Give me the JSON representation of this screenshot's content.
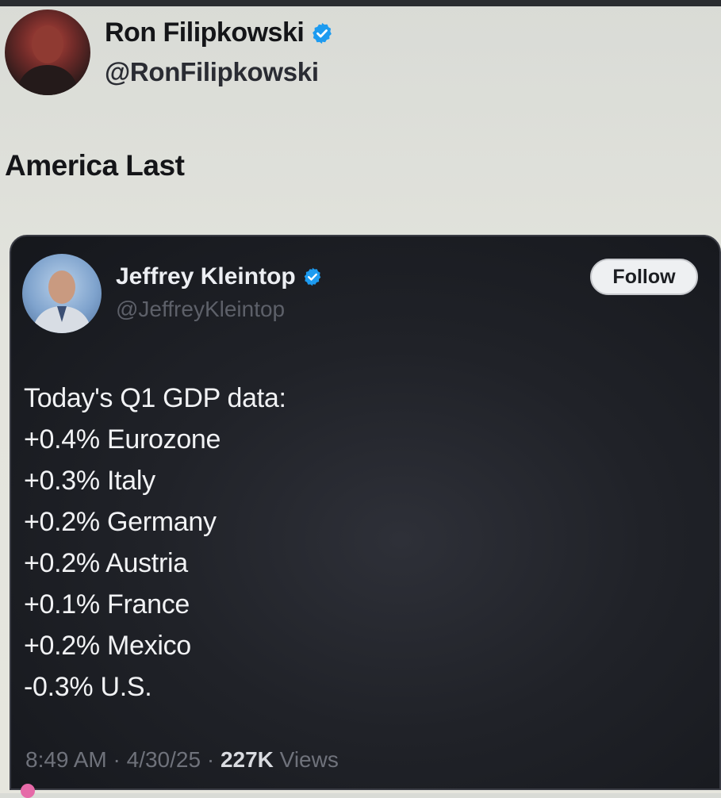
{
  "outer_tweet": {
    "display_name": "Ron Filipkowski",
    "handle": "@RonFilipkowski",
    "text": "America Last",
    "avatar_icon": "user-avatar"
  },
  "quoted_tweet": {
    "display_name": "Jeffrey Kleintop",
    "handle": "@JeffreyKleintop",
    "follow_label": "Follow",
    "lines": [
      "Today's Q1 GDP data:",
      "+0.4% Eurozone",
      "+0.3% Italy",
      "+0.2% Germany",
      "+0.2% Austria",
      "+0.1% France",
      "+0.2% Mexico",
      "-0.3% U.S."
    ],
    "time": "8:49 AM",
    "separator": "·",
    "date": "4/30/25",
    "views_count": "227K",
    "views_label": "Views"
  },
  "colors": {
    "verified_badge": "#1d9bf0",
    "card_background": "#1c1e24",
    "page_background": "#e3e4dd"
  }
}
